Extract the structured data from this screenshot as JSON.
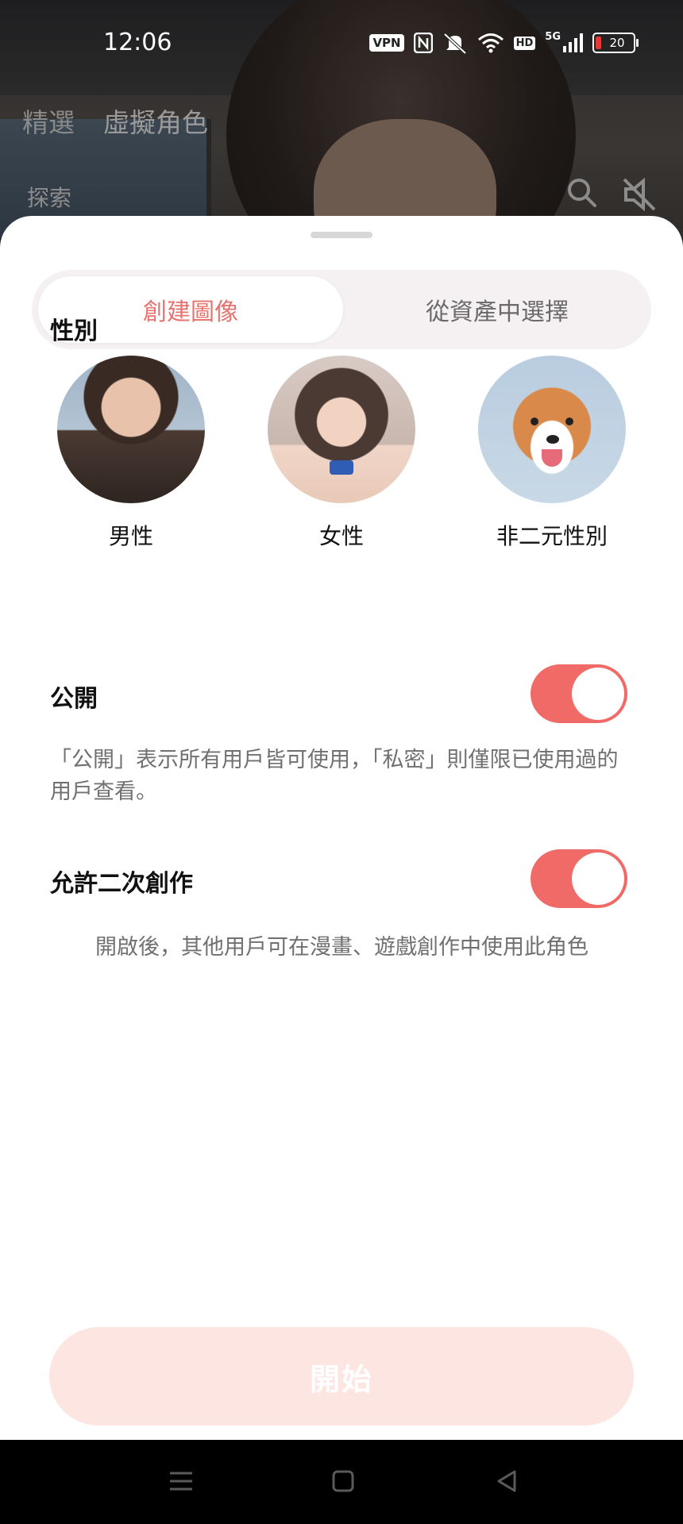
{
  "status_bar": {
    "time": "12:06",
    "vpn": "VPN",
    "hd": "HD",
    "network": "5G",
    "battery": "20"
  },
  "background_app": {
    "tabs": [
      "精選",
      "虛擬角色"
    ],
    "explore": "探索"
  },
  "sheet": {
    "segments": [
      {
        "label": "創建圖像",
        "active": true
      },
      {
        "label": "從資產中選擇",
        "active": false
      }
    ],
    "gender_title": "性別",
    "genders": [
      {
        "label": "男性",
        "avatar": "male-avatar"
      },
      {
        "label": "女性",
        "avatar": "female-avatar"
      },
      {
        "label": "非二元性別",
        "avatar": "dog-avatar"
      }
    ],
    "public": {
      "label": "公開",
      "on": true,
      "description": "「公開」表示所有用戶皆可使用，「私密」則僅限已使用過的用戶查看。"
    },
    "derivative": {
      "label": "允許二次創作",
      "on": true,
      "description": "開啟後，其他用戶可在漫畫、遊戲創作中使用此角色"
    },
    "start_label": "開始"
  },
  "colors": {
    "accent": "#f06b67",
    "accent_text": "#e8726e",
    "start_disabled_bg": "#fde6e2"
  }
}
